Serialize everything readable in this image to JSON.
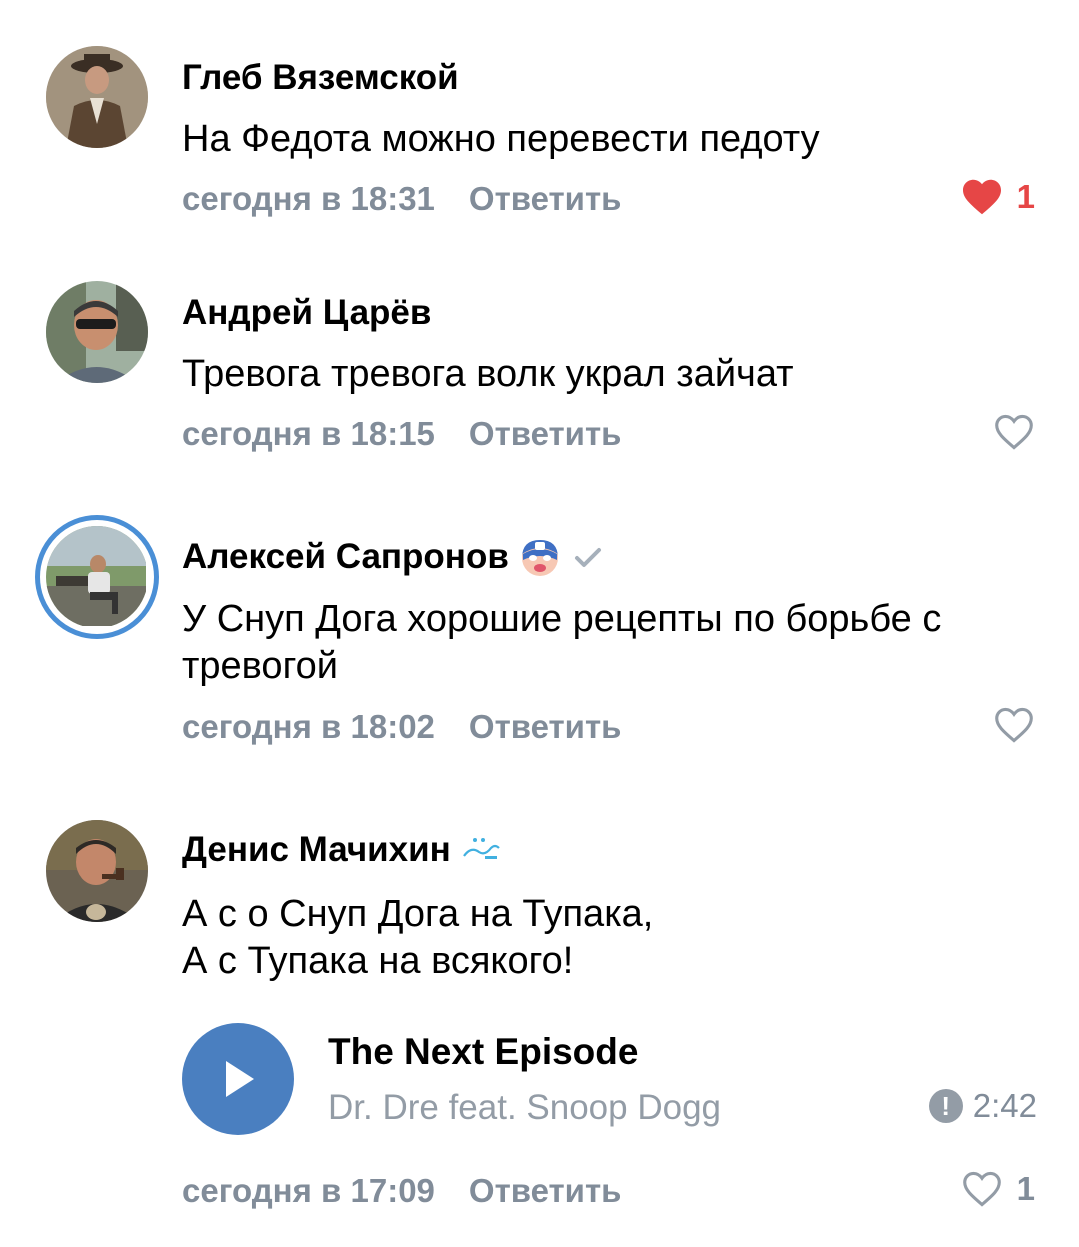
{
  "comments": [
    {
      "author": "Глеб Вяземской",
      "text": "На Федота можно перевести педоту",
      "time": "сегодня в 18:31",
      "reply_label": "Ответить",
      "likes": "1",
      "liked": true,
      "avatar_icon": "avatar-man-in-hat"
    },
    {
      "author": "Андрей Царёв",
      "text": "Тревога тревога волк украл зайчат",
      "time": "сегодня в 18:15",
      "reply_label": "Ответить",
      "liked": false,
      "avatar_icon": "avatar-man-sunglasses"
    },
    {
      "author": "Алексей Сапронов",
      "text": "У Снуп Дога хорошие рецепты по борьбе с тревогой",
      "time": "сегодня в 18:02",
      "reply_label": "Ответить",
      "liked": false,
      "avatar_icon": "avatar-man-bench",
      "badge_icon": "masked-hero-emoji-icon",
      "verified_icon": "verified-check-icon"
    },
    {
      "author": "Денис Мачихин",
      "text_lines": [
        "А с о Снуп Дога на Тупака,",
        "А с Тупака на всякого!"
      ],
      "time": "сегодня в 17:09",
      "reply_label": "Ответить",
      "likes": "1",
      "liked": false,
      "avatar_icon": "avatar-man-pipe",
      "badge_icon": "zenit-logo-icon",
      "audio": {
        "title": "The Next Episode",
        "artist": "Dr. Dre feat. Snoop Dogg",
        "duration": "2:42",
        "status_icon": "exclamation-circle-icon"
      }
    }
  ],
  "colors": {
    "secondary_text": "#818c99",
    "like_active": "#e64646",
    "accent_blue": "#4a7fc0",
    "story_ring": "#4a8fd6"
  }
}
